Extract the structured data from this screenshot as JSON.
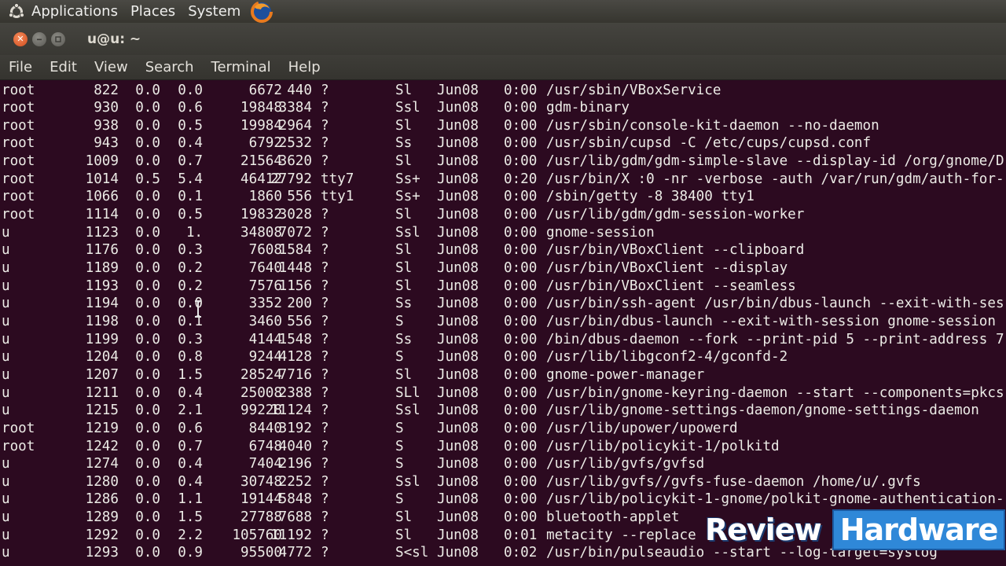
{
  "panel": {
    "menus": [
      "Applications",
      "Places",
      "System"
    ],
    "colors": {
      "background": "#3e3d38",
      "text": "#eeeeec"
    },
    "icons": [
      "ubuntu-logo-icon",
      "firefox-icon"
    ]
  },
  "window": {
    "title": "u@u: ~",
    "buttons": [
      "close-icon",
      "minimize-icon",
      "maximize-icon"
    ],
    "close_glyph": "✕",
    "colors": {
      "close": "#e25c2a",
      "titlebar": "#3c3b37"
    }
  },
  "menubar": {
    "items": [
      "File",
      "Edit",
      "View",
      "Search",
      "Terminal",
      "Help"
    ]
  },
  "terminal": {
    "colors": {
      "background": "#2c0a20",
      "foreground": "#ecebe6"
    },
    "rows": [
      [
        "root",
        "822",
        "0.0",
        "0.0",
        "6672",
        "440",
        "?",
        "Sl",
        "Jun08",
        "0:00",
        "/usr/sbin/VBoxService"
      ],
      [
        "root",
        "930",
        "0.0",
        "0.6",
        "19848",
        "3384",
        "?",
        "Ssl",
        "Jun08",
        "0:00",
        "gdm-binary"
      ],
      [
        "root",
        "938",
        "0.0",
        "0.5",
        "19984",
        "2964",
        "?",
        "Sl",
        "Jun08",
        "0:00",
        "/usr/sbin/console-kit-daemon --no-daemon"
      ],
      [
        "root",
        "943",
        "0.0",
        "0.4",
        "6792",
        "2532",
        "?",
        "Ss",
        "Jun08",
        "0:00",
        "/usr/sbin/cupsd -C /etc/cups/cupsd.conf"
      ],
      [
        "root",
        "1009",
        "0.0",
        "0.7",
        "21564",
        "3620",
        "?",
        "Sl",
        "Jun08",
        "0:00",
        "/usr/lib/gdm/gdm-simple-slave --display-id /org/gnome/D"
      ],
      [
        "root",
        "1014",
        "0.5",
        "5.4",
        "46412",
        "27792",
        "tty7",
        "Ss+",
        "Jun08",
        "0:20",
        "/usr/bin/X :0 -nr -verbose -auth /var/run/gdm/auth-for-"
      ],
      [
        "root",
        "1066",
        "0.0",
        "0.1",
        "1860",
        "556",
        "tty1",
        "Ss+",
        "Jun08",
        "0:00",
        "/sbin/getty -8 38400 tty1"
      ],
      [
        "root",
        "1114",
        "0.0",
        "0.5",
        "19832",
        "3028",
        "?",
        "Sl",
        "Jun08",
        "0:00",
        "/usr/lib/gdm/gdm-session-worker"
      ],
      [
        "u",
        "1123",
        "0.0",
        "1.",
        "34808",
        "7072",
        "?",
        "Ssl",
        "Jun08",
        "0:00",
        "gnome-session"
      ],
      [
        "u",
        "1176",
        "0.0",
        "0.3",
        "7608",
        "1584",
        "?",
        "Sl",
        "Jun08",
        "0:00",
        "/usr/bin/VBoxClient --clipboard"
      ],
      [
        "u",
        "1189",
        "0.0",
        "0.2",
        "7640",
        "1448",
        "?",
        "Sl",
        "Jun08",
        "0:00",
        "/usr/bin/VBoxClient --display"
      ],
      [
        "u",
        "1193",
        "0.0",
        "0.2",
        "7576",
        "1156",
        "?",
        "Sl",
        "Jun08",
        "0:00",
        "/usr/bin/VBoxClient --seamless"
      ],
      [
        "u",
        "1194",
        "0.0",
        "0.0",
        "3352",
        "200",
        "?",
        "Ss",
        "Jun08",
        "0:00",
        "/usr/bin/ssh-agent /usr/bin/dbus-launch --exit-with-ses"
      ],
      [
        "u",
        "1198",
        "0.0",
        "0.1",
        "3460",
        "556",
        "?",
        "S",
        "Jun08",
        "0:00",
        "/usr/bin/dbus-launch --exit-with-session gnome-session"
      ],
      [
        "u",
        "1199",
        "0.0",
        "0.3",
        "4144",
        "1548",
        "?",
        "Ss",
        "Jun08",
        "0:00",
        "/bin/dbus-daemon --fork --print-pid 5 --print-address 7"
      ],
      [
        "u",
        "1204",
        "0.0",
        "0.8",
        "9244",
        "4128",
        "?",
        "S",
        "Jun08",
        "0:00",
        "/usr/lib/libgconf2-4/gconfd-2"
      ],
      [
        "u",
        "1207",
        "0.0",
        "1.5",
        "28524",
        "7716",
        "?",
        "Sl",
        "Jun08",
        "0:00",
        "gnome-power-manager"
      ],
      [
        "u",
        "1211",
        "0.0",
        "0.4",
        "25008",
        "2388",
        "?",
        "SLl",
        "Jun08",
        "0:00",
        "/usr/bin/gnome-keyring-daemon --start --components=pkcs"
      ],
      [
        "u",
        "1215",
        "0.0",
        "2.1",
        "99228",
        "11124",
        "?",
        "Ssl",
        "Jun08",
        "0:00",
        "/usr/lib/gnome-settings-daemon/gnome-settings-daemon"
      ],
      [
        "root",
        "1219",
        "0.0",
        "0.6",
        "8440",
        "3192",
        "?",
        "S",
        "Jun08",
        "0:00",
        "/usr/lib/upower/upowerd"
      ],
      [
        "root",
        "1242",
        "0.0",
        "0.7",
        "6748",
        "4040",
        "?",
        "S",
        "Jun08",
        "0:00",
        "/usr/lib/policykit-1/polkitd"
      ],
      [
        "u",
        "1274",
        "0.0",
        "0.4",
        "7404",
        "2196",
        "?",
        "S",
        "Jun08",
        "0:00",
        "/usr/lib/gvfs/gvfsd"
      ],
      [
        "u",
        "1280",
        "0.0",
        "0.4",
        "30748",
        "2252",
        "?",
        "Ssl",
        "Jun08",
        "0:00",
        "/usr/lib/gvfs//gvfs-fuse-daemon /home/u/.gvfs"
      ],
      [
        "u",
        "1286",
        "0.0",
        "1.1",
        "19144",
        "5848",
        "?",
        "S",
        "Jun08",
        "0:00",
        "/usr/lib/policykit-1-gnome/polkit-gnome-authentication-"
      ],
      [
        "u",
        "1289",
        "0.0",
        "1.5",
        "27788",
        "7688",
        "?",
        "Sl",
        "Jun08",
        "0:00",
        "bluetooth-applet"
      ],
      [
        "u",
        "1292",
        "0.0",
        "2.2",
        "105760",
        "11192",
        "?",
        "Sl",
        "Jun08",
        "0:01",
        "metacity --replace"
      ],
      [
        "u",
        "1293",
        "0.0",
        "0.9",
        "95500",
        "4772",
        "?",
        "S<sl",
        "Jun08",
        "0:02",
        "/usr/bin/pulseaudio --start --log-target=syslog"
      ]
    ]
  },
  "watermark": {
    "review": "Review",
    "hardware": "Hardware",
    "colors": {
      "hardware_bg": "#2f88d8",
      "text": "#ffffff"
    }
  }
}
